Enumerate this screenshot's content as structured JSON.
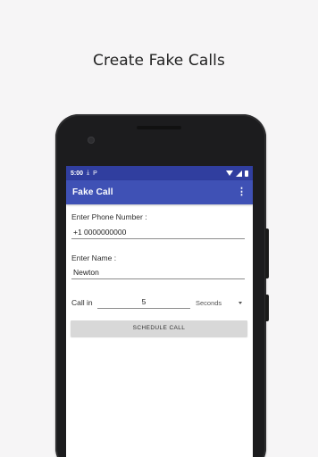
{
  "promo": {
    "headline": "Create Fake Calls"
  },
  "status_bar": {
    "time": "5:00",
    "left_icons": [
      "download-icon",
      "parking-icon"
    ],
    "p_glyph": "P",
    "right_icons": [
      "wifi-icon",
      "signal-icon",
      "battery-icon"
    ]
  },
  "app_bar": {
    "title": "Fake Call",
    "menu_icon": "more-vert-icon"
  },
  "form": {
    "phone_label": "Enter Phone Number :",
    "phone_value": "+1 0000000000",
    "name_label": "Enter Name :",
    "name_value": "Newton",
    "call_in_label": "Call in",
    "call_in_value": "5",
    "unit_selected": "Seconds",
    "schedule_label": "SCHEDULE CALL"
  },
  "colors": {
    "status_bar": "#303e9f",
    "app_bar": "#3f51b5",
    "button": "#d8d8d8",
    "background": "#f6f5f6"
  }
}
